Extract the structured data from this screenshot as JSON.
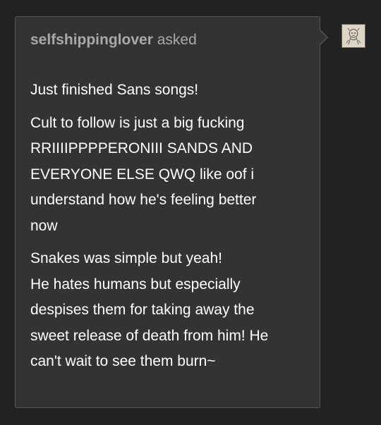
{
  "ask": {
    "asker_name": "selfshippinglover",
    "asked_label": "asked",
    "paragraphs": [
      [
        "Just finished Sans songs!"
      ],
      [
        "Cult to follow is just a big fucking",
        "RRIIIIPPPPERONIII SANDS AND",
        "EVERYONE ELSE QWQ like oof i",
        "understand how he's feeling better",
        "now"
      ],
      [
        "Snakes was simple but yeah!",
        "He hates humans but especially",
        "despises them for taking away the",
        "sweet release of death from him! He",
        "can't wait to see them burn~"
      ]
    ]
  },
  "avatar": {
    "icon": "sketch-character-avatar"
  },
  "colors": {
    "background": "#222222",
    "card": "#333333",
    "card_border": "#555555",
    "asker_text": "#a9a9a9",
    "body_text": "#ffffff"
  }
}
